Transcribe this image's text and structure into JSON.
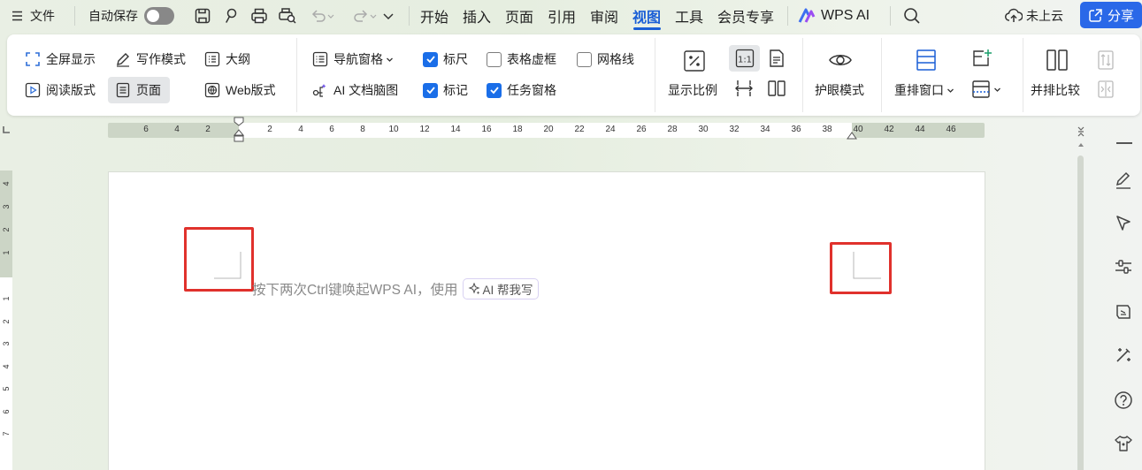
{
  "titlebar": {
    "file_menu": "文件",
    "autosave": "自动保存",
    "menus": [
      "开始",
      "插入",
      "页面",
      "引用",
      "审阅",
      "视图",
      "工具",
      "会员专享"
    ],
    "active_menu": "视图",
    "wps_ai": "WPS AI",
    "cloud": "未上云",
    "share": "分享"
  },
  "ribbon": {
    "fullscreen": "全屏显示",
    "writing_mode": "写作模式",
    "outline": "大纲",
    "read_mode": "阅读版式",
    "page_mode": "页面",
    "web_mode": "Web版式",
    "nav_pane": "导航窗格",
    "ai_mindmap": "AI 文档脑图",
    "ruler": {
      "label": "标尺",
      "checked": true
    },
    "table_gridlines": {
      "label": "表格虚框",
      "checked": false
    },
    "gridlines": {
      "label": "网格线",
      "checked": false
    },
    "marks": {
      "label": "标记",
      "checked": true
    },
    "task_pane": {
      "label": "任务窗格",
      "checked": true
    },
    "zoom": "显示比例",
    "eye_mode": "护眼模式",
    "rearrange": "重排窗口",
    "side_by_side": "并排比较"
  },
  "ruler": {
    "left_ticks": [
      "6",
      "4",
      "2"
    ],
    "ticks": [
      "2",
      "4",
      "6",
      "8",
      "10",
      "12",
      "14",
      "16",
      "18",
      "20",
      "22",
      "24",
      "26",
      "28",
      "30",
      "32",
      "34",
      "36",
      "38",
      "40",
      "42",
      "44",
      "46"
    ],
    "vertical_top": [
      "4",
      "3",
      "2",
      "1"
    ],
    "vertical_bottom": [
      "1",
      "2",
      "3",
      "4",
      "5",
      "6",
      "7"
    ]
  },
  "document": {
    "hint": "按下两次Ctrl键唤起WPS AI，使用",
    "ai_button": "AI 帮我写"
  },
  "colors": {
    "accent": "#1a5fd6",
    "highlight": "#e0312c"
  }
}
